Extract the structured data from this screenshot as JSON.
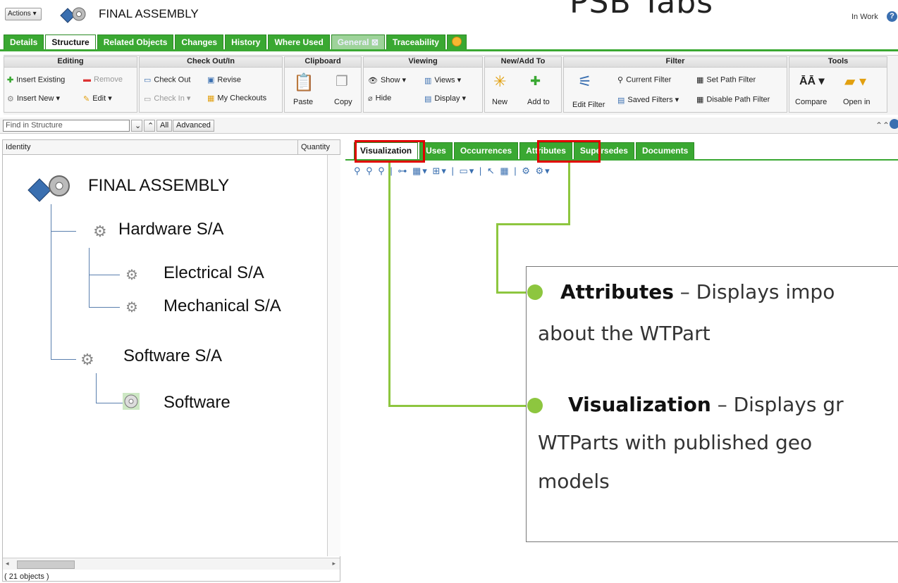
{
  "header": {
    "actions_label": "Actions",
    "title": "FINAL ASSEMBLY",
    "slide_title": "PSB Tabs",
    "status": "In Work"
  },
  "tabs": [
    "Details",
    "Structure",
    "Related Objects",
    "Changes",
    "History",
    "Where Used",
    "General",
    "Traceability"
  ],
  "active_tab": "Structure",
  "ribbon": {
    "editing": {
      "title": "Editing",
      "insert_existing": "Insert Existing",
      "remove": "Remove",
      "insert_new": "Insert New",
      "edit": "Edit"
    },
    "checkout": {
      "title": "Check Out/In",
      "check_out": "Check Out",
      "revise": "Revise",
      "check_in": "Check In",
      "my_checkouts": "My Checkouts"
    },
    "clipboard": {
      "title": "Clipboard",
      "paste": "Paste",
      "copy": "Copy"
    },
    "viewing": {
      "title": "Viewing",
      "show": "Show",
      "views": "Views",
      "hide": "Hide",
      "display": "Display"
    },
    "newadd": {
      "title": "New/Add To",
      "new": "New",
      "add_to": "Add to"
    },
    "filter": {
      "title": "Filter",
      "edit_filter": "Edit Filter",
      "current_filter": "Current Filter",
      "set_path_filter": "Set Path Filter",
      "saved_filters": "Saved Filters",
      "disable_path_filter": "Disable Path Filter"
    },
    "tools": {
      "title": "Tools",
      "compare": "Compare",
      "open_in": "Open in"
    }
  },
  "findbar": {
    "placeholder": "Find in Structure",
    "all": "All",
    "advanced": "Advanced"
  },
  "tree": {
    "col_identity": "Identity",
    "col_quantity": "Quantity",
    "nodes": [
      "FINAL ASSEMBLY",
      "Hardware S/A",
      "Electrical S/A",
      "Mechanical S/A",
      "Software S/A",
      "Software"
    ],
    "footer": "( 21 objects )"
  },
  "right_tabs": [
    "Visualization",
    "Uses",
    "Occurrences",
    "Attributes",
    "Supersedes",
    "Documents"
  ],
  "callout": {
    "attr_title": "Attributes",
    "attr_rest": " – Displays impo",
    "attr_line2": "about the WTPart",
    "vis_title": "Visualization",
    "vis_rest": " – Displays gr",
    "vis_line2": "WTParts with published geo",
    "vis_line3": "models"
  },
  "colors": {
    "tab_green": "#3aa832",
    "highlight_red": "#e00000",
    "connector_green": "#8dc63f"
  }
}
